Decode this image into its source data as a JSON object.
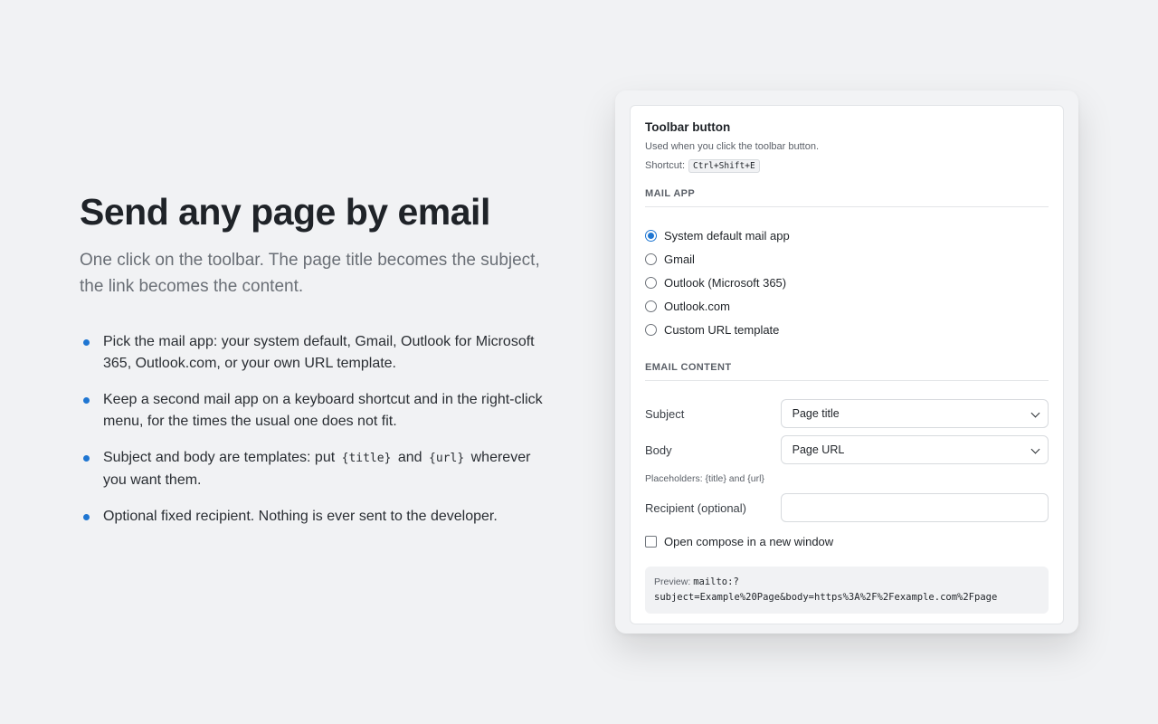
{
  "hero": {
    "headline": "Send any page by email",
    "subhead": "One click on the toolbar. The page title becomes the subject, the link becomes the content.",
    "features": [
      {
        "text": "Pick the mail app: your system default, Gmail, Outlook for Microsoft 365, Outlook.com, or your own URL template."
      },
      {
        "text": "Keep a second mail app on a keyboard shortcut and in the right-click menu, for the times the usual one does not fit."
      },
      {
        "before": "Subject and body are templates: put",
        "code1": "{title}",
        "middle": "and",
        "code2": "{url}",
        "after": "wherever you want them."
      },
      {
        "text": "Optional fixed recipient. Nothing is ever sent to the developer."
      }
    ],
    "bullet_color": "#1f76d2"
  },
  "settings": {
    "title": "Toolbar button",
    "description": "Used when you click the toolbar button.",
    "shortcut_label": "Shortcut:",
    "shortcut_key": "Ctrl+Shift+E",
    "mail_app_section": "MAIL APP",
    "mail_apps": [
      {
        "label": "System default mail app",
        "selected": true
      },
      {
        "label": "Gmail",
        "selected": false
      },
      {
        "label": "Outlook (Microsoft 365)",
        "selected": false
      },
      {
        "label": "Outlook.com",
        "selected": false
      },
      {
        "label": "Custom URL template",
        "selected": false
      }
    ],
    "email_content_section": "EMAIL CONTENT",
    "subject_label": "Subject",
    "subject_value": "Page title",
    "body_label": "Body",
    "body_value": "Page URL",
    "placeholders_hint": "Placeholders: {title} and {url}",
    "recipient_label": "Recipient (optional)",
    "recipient_value": "",
    "new_window_label": "Open compose in a new window",
    "new_window_checked": false,
    "preview_label": "Preview:",
    "preview_line1": "mailto:?",
    "preview_line2": "subject=Example%20Page&body=https%3A%2F%2Fexample.com%2Fpage",
    "accent_color": "#1f76d2"
  }
}
